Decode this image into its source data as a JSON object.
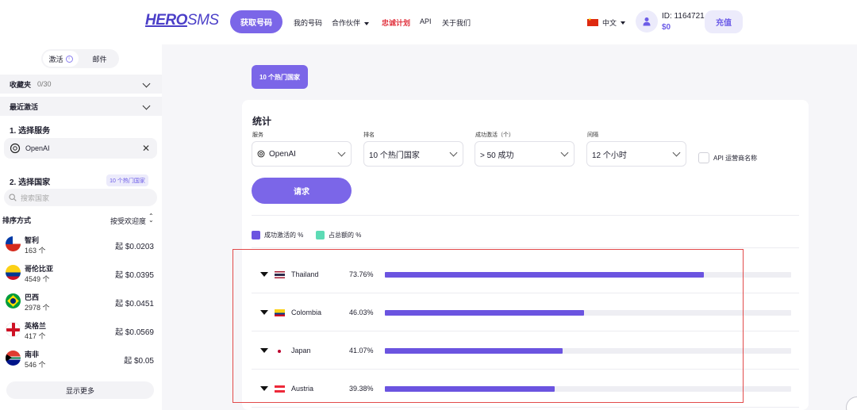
{
  "header": {
    "logo_hero": "HERO",
    "logo_sms": "SMS",
    "get_number": "获取号码",
    "nav": [
      "我的号码",
      "合作伙伴",
      "忠诚计划",
      "API",
      "关于我们"
    ],
    "lang": "中文",
    "account_id": "ID: 1164721",
    "balance": "$0",
    "topup": "充值"
  },
  "sidebar": {
    "tabs": [
      "激活",
      "邮件"
    ],
    "favorites_label": "收藏夹",
    "favorites_count": "0/30",
    "recent_label": "最近激活",
    "step1": "1. 选择服务",
    "service": "OpenAI",
    "step2": "2. 选择国家",
    "top_badge": "10 个热门国家",
    "search_placeholder": "搜索国家",
    "sort_label": "排序方式",
    "sort_value": "按受欢迎度",
    "countries": [
      {
        "name": "智利",
        "count": "163 个",
        "price": "起 $0.0203"
      },
      {
        "name": "哥伦比亚",
        "count": "4549 个",
        "price": "起 $0.0395"
      },
      {
        "name": "巴西",
        "count": "2978 个",
        "price": "起 $0.0451"
      },
      {
        "name": "英格兰",
        "count": "417 个",
        "price": "起 $0.0569"
      },
      {
        "name": "南非",
        "count": "546 个",
        "price": "起 $0.05"
      }
    ],
    "show_more": "显示更多"
  },
  "main": {
    "top_tab": "10 个热门国家",
    "stats_title": "统计",
    "filters": {
      "service_label": "服务",
      "service_value": "OpenAI",
      "rank_label": "排名",
      "rank_value": "10 个热门国家",
      "success_label": "成功激活（个）",
      "success_value": "> 50 成功",
      "interval_label": "间隔",
      "interval_value": "12 个小时"
    },
    "operator_checkbox": "API 运营商名称",
    "request_button": "请求",
    "legend": [
      {
        "label": "成功激活的 %",
        "color": "#6b54e0"
      },
      {
        "label": "占总额的 %",
        "color": "#5ddbb5"
      }
    ],
    "rows": [
      {
        "country": "Thailand",
        "pct_label": "73.76%",
        "value": 73.76
      },
      {
        "country": "Colombia",
        "pct_label": "46.03%",
        "value": 46.03
      },
      {
        "country": "Japan",
        "pct_label": "41.07%",
        "value": 41.07
      },
      {
        "country": "Austria",
        "pct_label": "39.38%",
        "value": 39.38
      }
    ],
    "bar_scale_max": 94
  }
}
